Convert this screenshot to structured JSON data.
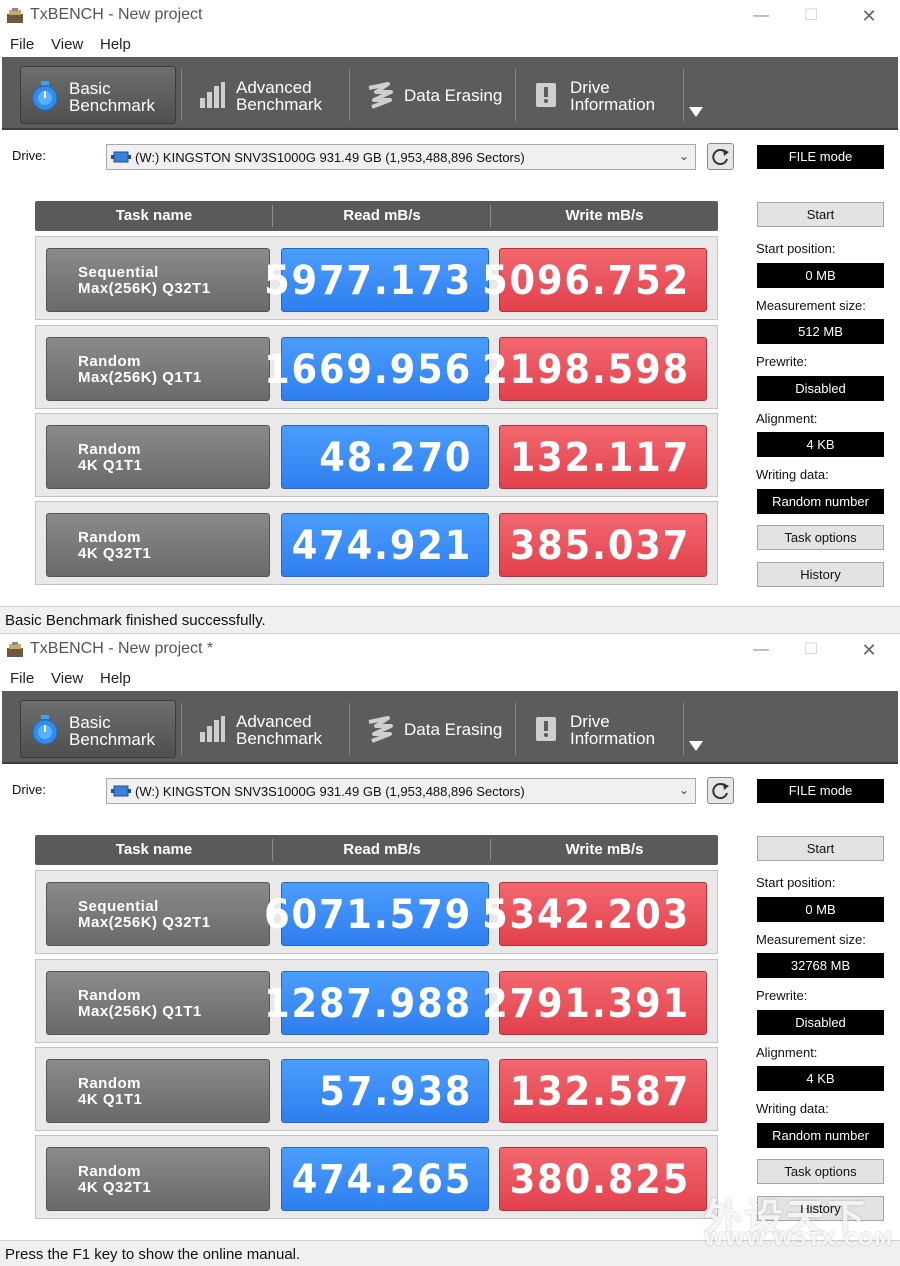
{
  "windows": [
    {
      "title": "TxBENCH - New project",
      "menu": [
        "File",
        "View",
        "Help"
      ],
      "tabs": [
        {
          "label": "Basic\nBenchmark",
          "icon": "stopwatch-icon",
          "active": true
        },
        {
          "label": "Advanced\nBenchmark",
          "icon": "bar-chart-icon",
          "active": false
        },
        {
          "label": "Data Erasing",
          "icon": "erase-icon",
          "active": false
        },
        {
          "label": "Drive\nInformation",
          "icon": "drive-info-icon",
          "active": false
        }
      ],
      "drive_label": "Drive:",
      "drive_value": "(W:) KINGSTON SNV3S1000G  931.49 GB (1,953,488,896 Sectors)",
      "file_mode": "FILE mode",
      "headers": {
        "task": "Task name",
        "read": "Read mB/s",
        "write": "Write mB/s"
      },
      "rows": [
        {
          "line1": "Sequential",
          "line2": "Max(256K) Q32T1",
          "read": "5977.173",
          "write": "5096.752"
        },
        {
          "line1": "Random",
          "line2": "Max(256K) Q1T1",
          "read": "1669.956",
          "write": "2198.598"
        },
        {
          "line1": "Random",
          "line2": "4K Q1T1",
          "read": "48.270",
          "write": "132.117"
        },
        {
          "line1": "Random",
          "line2": "4K Q32T1",
          "read": "474.921",
          "write": "385.037"
        }
      ],
      "side": {
        "start_label": "Start",
        "start_position_label": "Start position:",
        "start_position": "0 MB",
        "measurement_size_label": "Measurement size:",
        "measurement_size": "512 MB",
        "prewrite_label": "Prewrite:",
        "prewrite": "Disabled",
        "alignment_label": "Alignment:",
        "alignment": "4 KB",
        "writing_data_label": "Writing data:",
        "writing_data": "Random number",
        "task_options_label": "Task options",
        "history_label": "History"
      },
      "status": "Basic Benchmark finished successfully."
    },
    {
      "title": "TxBENCH - New project *",
      "menu": [
        "File",
        "View",
        "Help"
      ],
      "tabs": [
        {
          "label": "Basic\nBenchmark",
          "icon": "stopwatch-icon",
          "active": true
        },
        {
          "label": "Advanced\nBenchmark",
          "icon": "bar-chart-icon",
          "active": false
        },
        {
          "label": "Data Erasing",
          "icon": "erase-icon",
          "active": false
        },
        {
          "label": "Drive\nInformation",
          "icon": "drive-info-icon",
          "active": false
        }
      ],
      "drive_label": "Drive:",
      "drive_value": "(W:) KINGSTON SNV3S1000G  931.49 GB (1,953,488,896 Sectors)",
      "file_mode": "FILE mode",
      "headers": {
        "task": "Task name",
        "read": "Read mB/s",
        "write": "Write mB/s"
      },
      "rows": [
        {
          "line1": "Sequential",
          "line2": "Max(256K) Q32T1",
          "read": "6071.579",
          "write": "5342.203"
        },
        {
          "line1": "Random",
          "line2": "Max(256K) Q1T1",
          "read": "1287.988",
          "write": "2791.391"
        },
        {
          "line1": "Random",
          "line2": "4K Q1T1",
          "read": "57.938",
          "write": "132.587"
        },
        {
          "line1": "Random",
          "line2": "4K Q32T1",
          "read": "474.265",
          "write": "380.825"
        }
      ],
      "side": {
        "start_label": "Start",
        "start_position_label": "Start position:",
        "start_position": "0 MB",
        "measurement_size_label": "Measurement size:",
        "measurement_size": "32768 MB",
        "prewrite_label": "Prewrite:",
        "prewrite": "Disabled",
        "alignment_label": "Alignment:",
        "alignment": "4 KB",
        "writing_data_label": "Writing data:",
        "writing_data": "Random number",
        "task_options_label": "Task options",
        "history_label": "History"
      },
      "status": "Press the F1 key to show the online manual."
    }
  ],
  "watermark": {
    "main": "外设天下",
    "sub": "WWW.WSTX.COM"
  },
  "colors": {
    "read": "#3b8cf6",
    "write": "#e8515b",
    "toolbar": "#5c5c5c"
  }
}
